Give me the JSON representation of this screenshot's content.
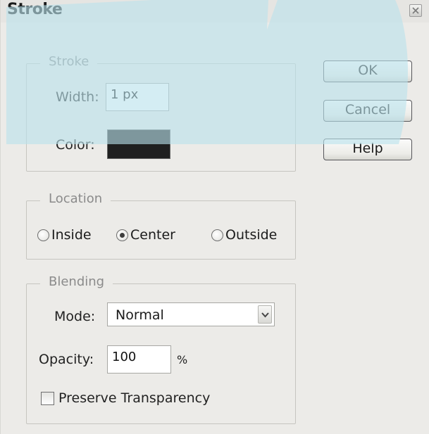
{
  "window": {
    "title": "Stroke"
  },
  "stroke": {
    "legend": "Stroke",
    "width_label": "Width:",
    "width_value": "1 px",
    "color_label": "Color:",
    "color_hex": "#1f1f1f"
  },
  "buttons": {
    "ok": "OK",
    "cancel": "Cancel",
    "help": "Help"
  },
  "location": {
    "legend": "Location",
    "options": [
      "Inside",
      "Center",
      "Outside"
    ],
    "selected": "Center"
  },
  "blending": {
    "legend": "Blending",
    "mode_label": "Mode:",
    "mode_value": "Normal",
    "opacity_label": "Opacity:",
    "opacity_value": "100",
    "opacity_unit": "%",
    "preserve_label": "Preserve Transparency",
    "preserve_checked": false
  },
  "icons": {
    "close": "close-icon",
    "dropdown": "chevron-down-icon"
  },
  "colors": {
    "dialog_bg": "#ecebe8",
    "overlay_tint": "#b9e2ec"
  }
}
